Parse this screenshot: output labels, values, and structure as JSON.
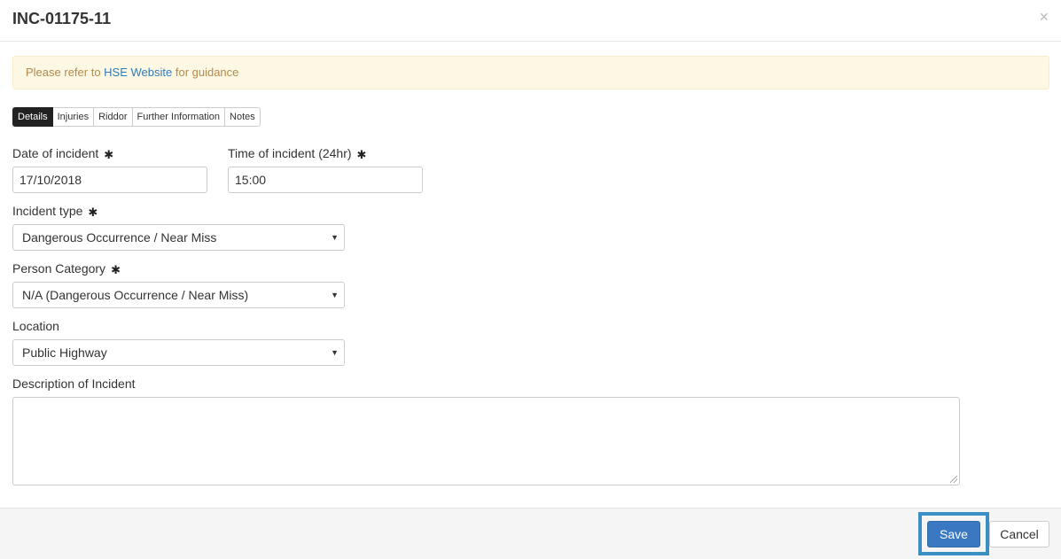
{
  "modal": {
    "title": "INC-01175-11",
    "close_glyph": "×"
  },
  "alert": {
    "prefix": "Please refer to ",
    "link_text": "HSE Website",
    "suffix": " for guidance"
  },
  "tabs": [
    {
      "label": "Details",
      "active": true
    },
    {
      "label": "Injuries",
      "active": false
    },
    {
      "label": "Riddor",
      "active": false
    },
    {
      "label": "Further Information",
      "active": false
    },
    {
      "label": "Notes",
      "active": false
    }
  ],
  "form": {
    "required_glyph": "✱",
    "date_label": "Date of incident",
    "date_value": "17/10/2018",
    "time_label": "Time of incident (24hr)",
    "time_value": "15:00",
    "incident_type_label": "Incident type",
    "incident_type_value": "Dangerous Occurrence / Near Miss",
    "person_category_label": "Person Category",
    "person_category_value": "N/A (Dangerous Occurrence / Near Miss)",
    "location_label": "Location",
    "location_value": "Public Highway",
    "description_label": "Description of Incident",
    "description_value": ""
  },
  "footer": {
    "save_label": "Save",
    "cancel_label": "Cancel"
  },
  "colors": {
    "save_button": "#3a78c2",
    "highlight": "#3a8fc4",
    "alert_bg": "#fcf8e3",
    "active_tab": "#222222"
  }
}
